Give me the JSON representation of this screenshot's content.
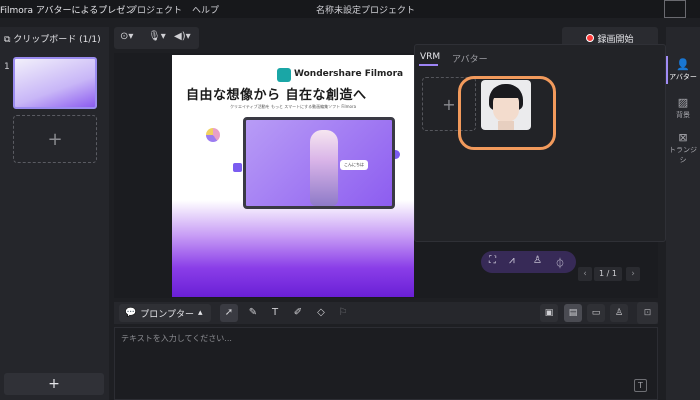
{
  "titlebar": {
    "app_name": "Filmora アバターによるプレゼン",
    "menu": [
      "プロジェクト",
      "ヘルプ"
    ],
    "window_title": "名称未設定プロジェクト"
  },
  "left_panel": {
    "header": "クリップボード (1/1)",
    "slide_number": "1",
    "add_slide": "+",
    "add_button": "+"
  },
  "record": {
    "label": "録画開始"
  },
  "avatar_popover": {
    "tabs": [
      "VRM",
      "アバター"
    ],
    "active_tab": "VRM",
    "add": "+"
  },
  "slide": {
    "brand": "Wondershare Filmora",
    "headline": "自由な想像から 自在な創造へ",
    "subline": "クリエイティブ活動を もっと スマートにする動画編集ソフト Filmora",
    "bubble": "こんにちは"
  },
  "right_panel": {
    "items": [
      {
        "label": "アバター",
        "icon": "person-icon"
      },
      {
        "label": "背景",
        "icon": "background-icon"
      },
      {
        "label": "トランジシ",
        "icon": "transition-icon"
      }
    ]
  },
  "pager": {
    "prev": "‹",
    "page": "1 / 1",
    "next": "›"
  },
  "bottom": {
    "prompter_label": "プロンプター",
    "placeholder": "テキストを入力してください..."
  },
  "colors": {
    "accent": "#9d84f5",
    "highlight_ring": "#f29a5c",
    "record": "#ff3b3b"
  }
}
